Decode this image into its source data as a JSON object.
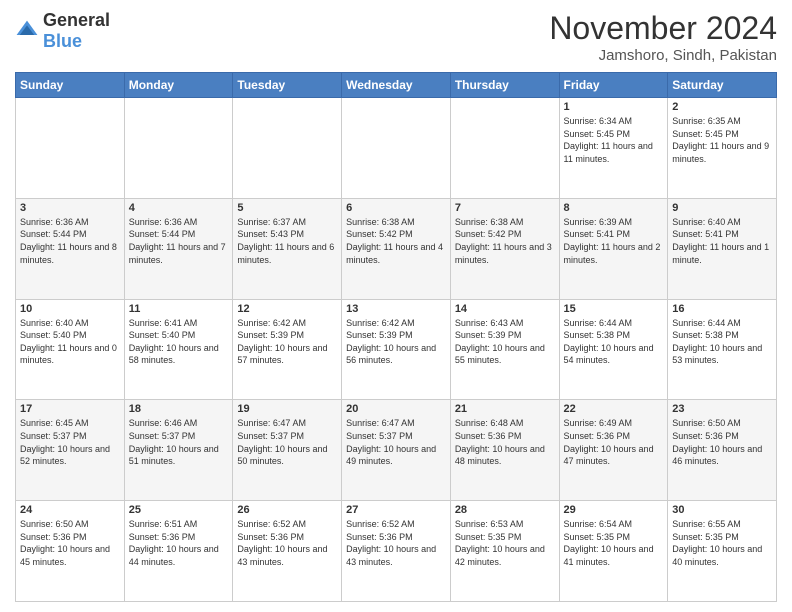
{
  "logo": {
    "general": "General",
    "blue": "Blue"
  },
  "title": "November 2024",
  "location": "Jamshoro, Sindh, Pakistan",
  "days_of_week": [
    "Sunday",
    "Monday",
    "Tuesday",
    "Wednesday",
    "Thursday",
    "Friday",
    "Saturday"
  ],
  "weeks": [
    [
      {
        "day": "",
        "info": ""
      },
      {
        "day": "",
        "info": ""
      },
      {
        "day": "",
        "info": ""
      },
      {
        "day": "",
        "info": ""
      },
      {
        "day": "",
        "info": ""
      },
      {
        "day": "1",
        "info": "Sunrise: 6:34 AM\nSunset: 5:45 PM\nDaylight: 11 hours and 11 minutes."
      },
      {
        "day": "2",
        "info": "Sunrise: 6:35 AM\nSunset: 5:45 PM\nDaylight: 11 hours and 9 minutes."
      }
    ],
    [
      {
        "day": "3",
        "info": "Sunrise: 6:36 AM\nSunset: 5:44 PM\nDaylight: 11 hours and 8 minutes."
      },
      {
        "day": "4",
        "info": "Sunrise: 6:36 AM\nSunset: 5:44 PM\nDaylight: 11 hours and 7 minutes."
      },
      {
        "day": "5",
        "info": "Sunrise: 6:37 AM\nSunset: 5:43 PM\nDaylight: 11 hours and 6 minutes."
      },
      {
        "day": "6",
        "info": "Sunrise: 6:38 AM\nSunset: 5:42 PM\nDaylight: 11 hours and 4 minutes."
      },
      {
        "day": "7",
        "info": "Sunrise: 6:38 AM\nSunset: 5:42 PM\nDaylight: 11 hours and 3 minutes."
      },
      {
        "day": "8",
        "info": "Sunrise: 6:39 AM\nSunset: 5:41 PM\nDaylight: 11 hours and 2 minutes."
      },
      {
        "day": "9",
        "info": "Sunrise: 6:40 AM\nSunset: 5:41 PM\nDaylight: 11 hours and 1 minute."
      }
    ],
    [
      {
        "day": "10",
        "info": "Sunrise: 6:40 AM\nSunset: 5:40 PM\nDaylight: 11 hours and 0 minutes."
      },
      {
        "day": "11",
        "info": "Sunrise: 6:41 AM\nSunset: 5:40 PM\nDaylight: 10 hours and 58 minutes."
      },
      {
        "day": "12",
        "info": "Sunrise: 6:42 AM\nSunset: 5:39 PM\nDaylight: 10 hours and 57 minutes."
      },
      {
        "day": "13",
        "info": "Sunrise: 6:42 AM\nSunset: 5:39 PM\nDaylight: 10 hours and 56 minutes."
      },
      {
        "day": "14",
        "info": "Sunrise: 6:43 AM\nSunset: 5:39 PM\nDaylight: 10 hours and 55 minutes."
      },
      {
        "day": "15",
        "info": "Sunrise: 6:44 AM\nSunset: 5:38 PM\nDaylight: 10 hours and 54 minutes."
      },
      {
        "day": "16",
        "info": "Sunrise: 6:44 AM\nSunset: 5:38 PM\nDaylight: 10 hours and 53 minutes."
      }
    ],
    [
      {
        "day": "17",
        "info": "Sunrise: 6:45 AM\nSunset: 5:37 PM\nDaylight: 10 hours and 52 minutes."
      },
      {
        "day": "18",
        "info": "Sunrise: 6:46 AM\nSunset: 5:37 PM\nDaylight: 10 hours and 51 minutes."
      },
      {
        "day": "19",
        "info": "Sunrise: 6:47 AM\nSunset: 5:37 PM\nDaylight: 10 hours and 50 minutes."
      },
      {
        "day": "20",
        "info": "Sunrise: 6:47 AM\nSunset: 5:37 PM\nDaylight: 10 hours and 49 minutes."
      },
      {
        "day": "21",
        "info": "Sunrise: 6:48 AM\nSunset: 5:36 PM\nDaylight: 10 hours and 48 minutes."
      },
      {
        "day": "22",
        "info": "Sunrise: 6:49 AM\nSunset: 5:36 PM\nDaylight: 10 hours and 47 minutes."
      },
      {
        "day": "23",
        "info": "Sunrise: 6:50 AM\nSunset: 5:36 PM\nDaylight: 10 hours and 46 minutes."
      }
    ],
    [
      {
        "day": "24",
        "info": "Sunrise: 6:50 AM\nSunset: 5:36 PM\nDaylight: 10 hours and 45 minutes."
      },
      {
        "day": "25",
        "info": "Sunrise: 6:51 AM\nSunset: 5:36 PM\nDaylight: 10 hours and 44 minutes."
      },
      {
        "day": "26",
        "info": "Sunrise: 6:52 AM\nSunset: 5:36 PM\nDaylight: 10 hours and 43 minutes."
      },
      {
        "day": "27",
        "info": "Sunrise: 6:52 AM\nSunset: 5:36 PM\nDaylight: 10 hours and 43 minutes."
      },
      {
        "day": "28",
        "info": "Sunrise: 6:53 AM\nSunset: 5:35 PM\nDaylight: 10 hours and 42 minutes."
      },
      {
        "day": "29",
        "info": "Sunrise: 6:54 AM\nSunset: 5:35 PM\nDaylight: 10 hours and 41 minutes."
      },
      {
        "day": "30",
        "info": "Sunrise: 6:55 AM\nSunset: 5:35 PM\nDaylight: 10 hours and 40 minutes."
      }
    ]
  ]
}
